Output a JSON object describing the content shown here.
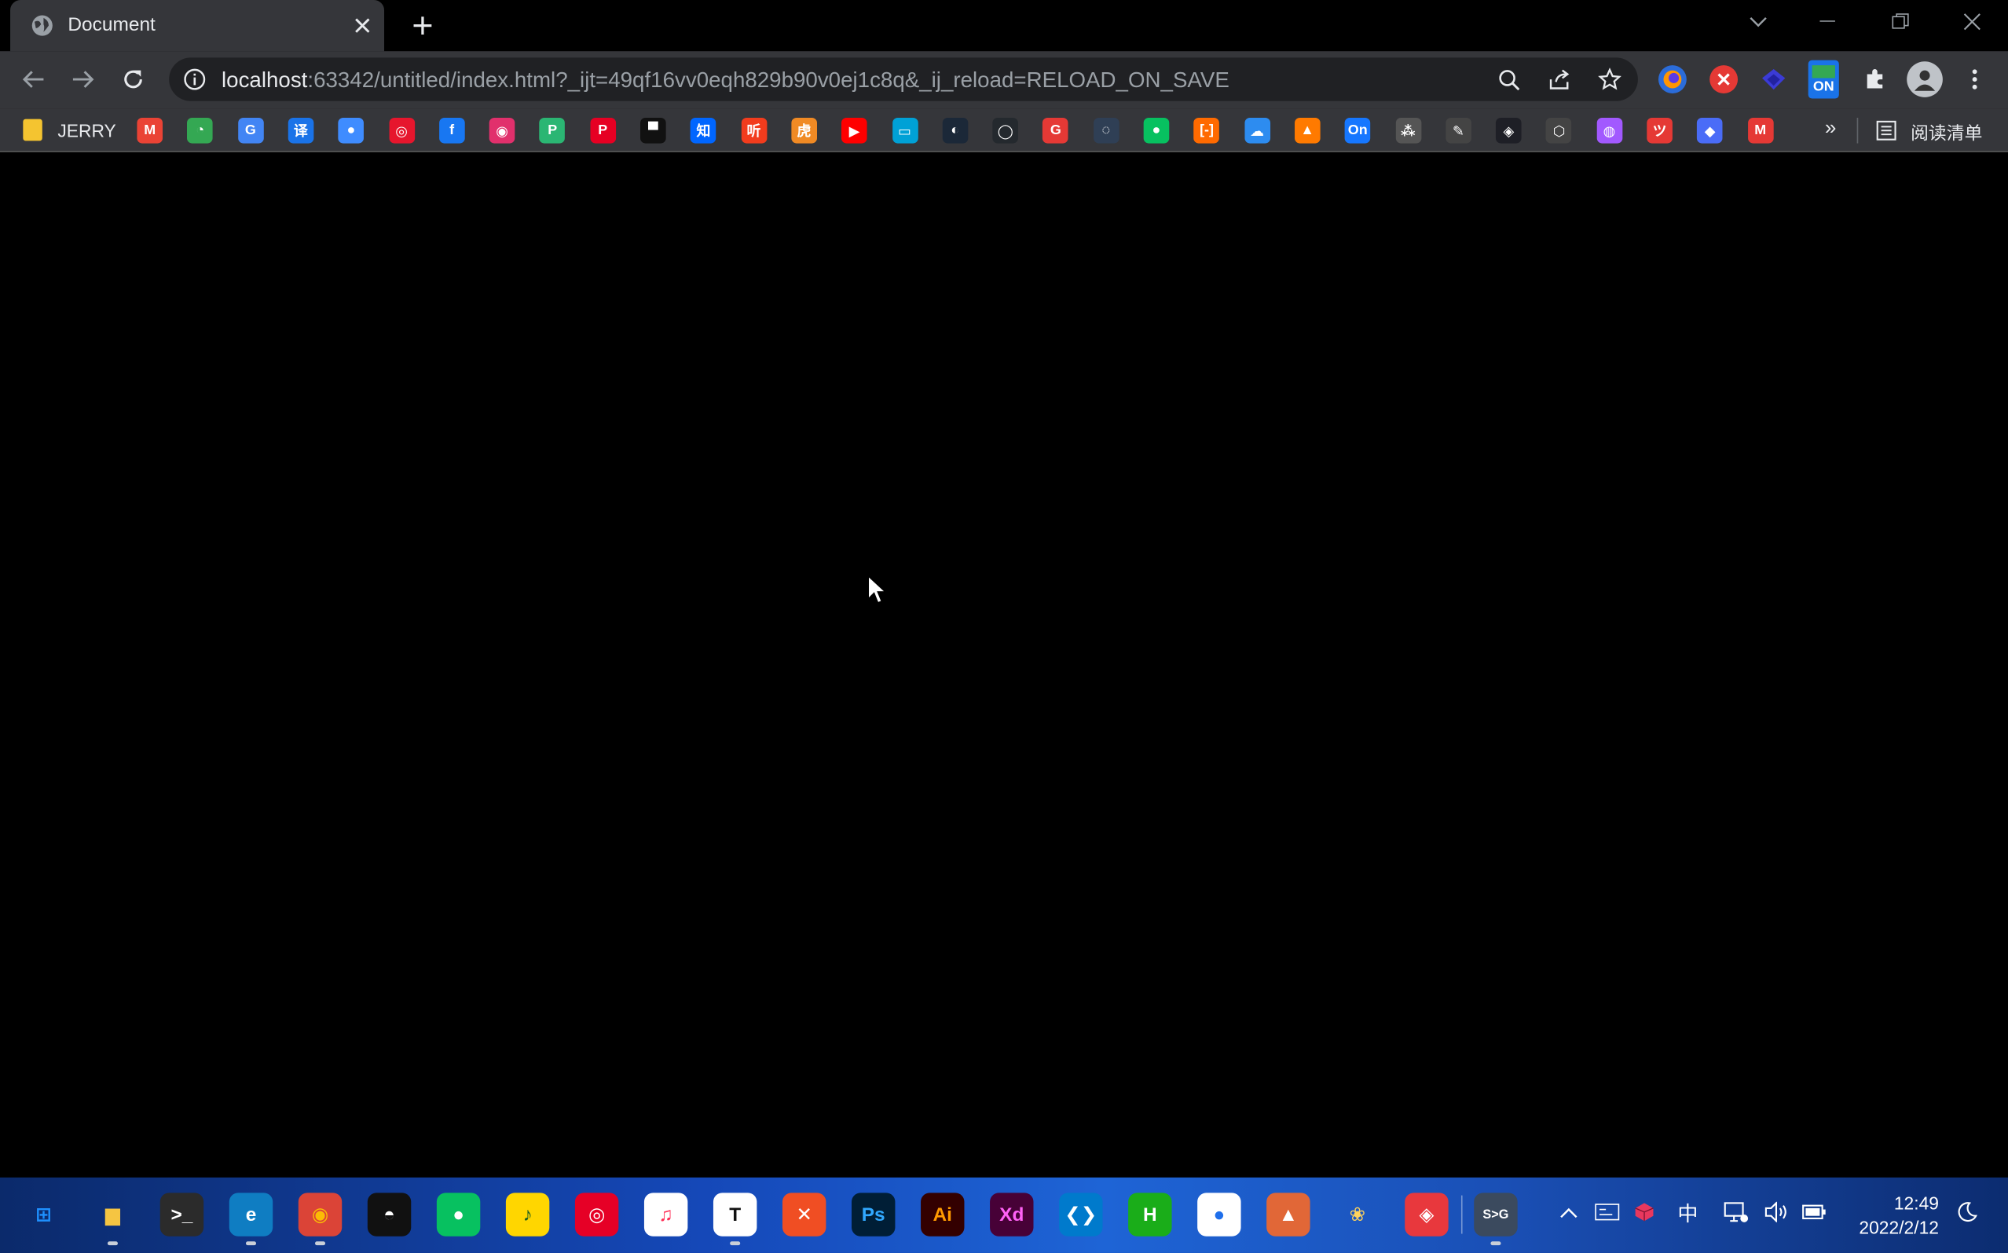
{
  "tab": {
    "title": "Document"
  },
  "address_bar": {
    "host": "localhost",
    "path": ":63342/untitled/index.html?_ijt=49qf16vv0eqh829b90v0ej1c8q&_ij_reload=RELOAD_ON_SAVE"
  },
  "extensions": [
    {
      "name": "ext-firefox-like-icon"
    },
    {
      "name": "ext-red-icon"
    },
    {
      "name": "ext-diamond-icon"
    },
    {
      "name": "ext-on-badge-icon",
      "label": "ON"
    },
    {
      "name": "puzzle-extensions-icon"
    },
    {
      "name": "profile-avatar"
    }
  ],
  "bookmarks": {
    "folder_label": "JERRY",
    "items": [
      {
        "name": "gmail",
        "glyph": "M",
        "color": "#ea4335"
      },
      {
        "name": "google-drive",
        "glyph": "◔",
        "color": "#34a853"
      },
      {
        "name": "google-translate",
        "glyph": "G",
        "color": "#4285f4"
      },
      {
        "name": "translate-yi",
        "glyph": "译",
        "color": "#1a73e8"
      },
      {
        "name": "globe",
        "glyph": "●",
        "color": "#3f8cff"
      },
      {
        "name": "weibo",
        "glyph": "◎",
        "color": "#e6162d"
      },
      {
        "name": "facebook",
        "glyph": "f",
        "color": "#1877f2"
      },
      {
        "name": "instagram",
        "glyph": "◉",
        "color": "#e1306c"
      },
      {
        "name": "p-app",
        "glyph": "P",
        "color": "#2bb673"
      },
      {
        "name": "pinterest",
        "glyph": "P",
        "color": "#e60023"
      },
      {
        "name": "unsplash",
        "glyph": "▀",
        "color": "#111111"
      },
      {
        "name": "zhihu",
        "glyph": "知",
        "color": "#0066ff"
      },
      {
        "name": "ting",
        "glyph": "听",
        "color": "#f23c1d"
      },
      {
        "name": "tiger",
        "glyph": "虎",
        "color": "#f08a24"
      },
      {
        "name": "youtube",
        "glyph": "▶",
        "color": "#ff0000"
      },
      {
        "name": "bilibili",
        "glyph": "▭",
        "color": "#00a1d6"
      },
      {
        "name": "steam",
        "glyph": "◐",
        "color": "#1b2838"
      },
      {
        "name": "github",
        "glyph": "◯",
        "color": "#24292e"
      },
      {
        "name": "g-red",
        "glyph": "G",
        "color": "#e53935"
      },
      {
        "name": "blue-circle",
        "glyph": "◌",
        "color": "#2f3f55"
      },
      {
        "name": "wechat",
        "glyph": "●",
        "color": "#07c160"
      },
      {
        "name": "aliyun",
        "glyph": "[-]",
        "color": "#ff6a00"
      },
      {
        "name": "cloud",
        "glyph": "☁",
        "color": "#2d8cf0"
      },
      {
        "name": "orange-app",
        "glyph": "▲",
        "color": "#ff7a00"
      },
      {
        "name": "on-app",
        "glyph": "On",
        "color": "#1677ff"
      },
      {
        "name": "dots-app",
        "glyph": "⁂",
        "color": "#555555"
      },
      {
        "name": "pen-app",
        "glyph": "✎",
        "color": "#444444"
      },
      {
        "name": "codepen",
        "glyph": "◈",
        "color": "#1e1f26"
      },
      {
        "name": "cube",
        "glyph": "⬡",
        "color": "#444444"
      },
      {
        "name": "figma",
        "glyph": "◍",
        "color": "#a259ff"
      },
      {
        "name": "red-logo",
        "glyph": "ツ",
        "color": "#e53935"
      },
      {
        "name": "blue-badge",
        "glyph": "◆",
        "color": "#4a6cf7"
      },
      {
        "name": "mail-logo",
        "glyph": "M",
        "color": "#e53935"
      }
    ],
    "reading_list": "阅读清单",
    "overflow": "»"
  },
  "taskbar": {
    "apps": [
      {
        "name": "start-button",
        "glyph": "⊞",
        "color": "#1e90ff",
        "bg": "transparent"
      },
      {
        "name": "file-explorer",
        "glyph": "▆",
        "color": "#f5c542",
        "bg": "transparent",
        "running": true
      },
      {
        "name": "terminal",
        "glyph": ">_",
        "color": "#ffffff",
        "bg": "#2b2b2b"
      },
      {
        "name": "edge",
        "glyph": "e",
        "color": "#ffffff",
        "bg": "#0f7dc2",
        "running": true
      },
      {
        "name": "chrome",
        "glyph": "◉",
        "color": "#fbbc05",
        "bg": "#db4437",
        "running": true
      },
      {
        "name": "qq",
        "glyph": "◓",
        "color": "#ffffff",
        "bg": "#111111"
      },
      {
        "name": "wechat",
        "glyph": "●",
        "color": "#ffffff",
        "bg": "#07c160"
      },
      {
        "name": "music-yellow",
        "glyph": "♪",
        "color": "#1b5e20",
        "bg": "#ffd600"
      },
      {
        "name": "netease-music",
        "glyph": "◎",
        "color": "#ffffff",
        "bg": "#e60026"
      },
      {
        "name": "itunes",
        "glyph": "♫",
        "color": "#ff2d55",
        "bg": "#ffffff"
      },
      {
        "name": "typora",
        "glyph": "T",
        "color": "#111111",
        "bg": "#ffffff",
        "running": true
      },
      {
        "name": "xmind",
        "glyph": "✕",
        "color": "#ffffff",
        "bg": "#f04e23"
      },
      {
        "name": "photoshop",
        "glyph": "Ps",
        "color": "#31a8ff",
        "bg": "#001e36"
      },
      {
        "name": "illustrator",
        "glyph": "Ai",
        "color": "#ff9a00",
        "bg": "#330000"
      },
      {
        "name": "adobe-xd",
        "glyph": "Xd",
        "color": "#ff61f6",
        "bg": "#470137"
      },
      {
        "name": "vscode",
        "glyph": "❮❯",
        "color": "#ffffff",
        "bg": "#007acc"
      },
      {
        "name": "hbuilder",
        "glyph": "H",
        "color": "#ffffff",
        "bg": "#1aad19"
      },
      {
        "name": "chat-bubble",
        "glyph": "●",
        "color": "#1f6feb",
        "bg": "#ffffff"
      },
      {
        "name": "matlab",
        "glyph": "▲",
        "color": "#ffffff",
        "bg": "#e16737"
      },
      {
        "name": "paw-app",
        "glyph": "❀",
        "color": "#ffd35c",
        "bg": "transparent"
      },
      {
        "name": "red-app",
        "glyph": "◈",
        "color": "#ffffff",
        "bg": "#e8383d"
      },
      {
        "name": "screen-app",
        "glyph": "S>G",
        "color": "#ffffff",
        "bg": "#3b4a5e",
        "running": true
      }
    ],
    "tray": {
      "ime": "中",
      "time": "12:49",
      "date": "2022/2/12"
    }
  }
}
